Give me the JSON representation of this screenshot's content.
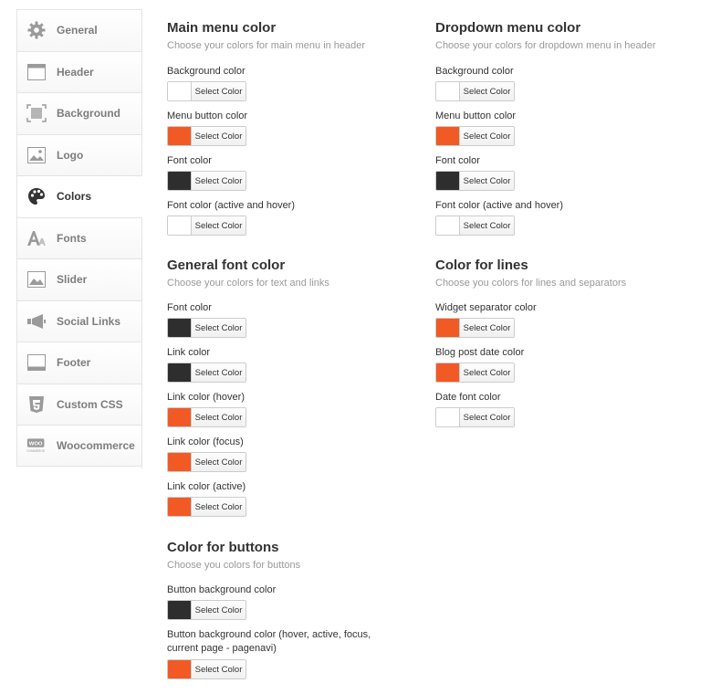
{
  "colors": {
    "orange": "#f15a24",
    "dark": "#2e2e2e",
    "white": "#ffffff"
  },
  "sidebar": {
    "items": [
      {
        "label": "General",
        "icon": "gear-icon",
        "active": false
      },
      {
        "label": "Header",
        "icon": "header-icon",
        "active": false
      },
      {
        "label": "Background",
        "icon": "background-icon",
        "active": false
      },
      {
        "label": "Logo",
        "icon": "image-icon",
        "active": false
      },
      {
        "label": "Colors",
        "icon": "palette-icon",
        "active": true
      },
      {
        "label": "Fonts",
        "icon": "font-icon",
        "active": false
      },
      {
        "label": "Slider",
        "icon": "slider-icon",
        "active": false
      },
      {
        "label": "Social Links",
        "icon": "megaphone-icon",
        "active": false
      },
      {
        "label": "Footer",
        "icon": "footer-icon",
        "active": false
      },
      {
        "label": "Custom CSS",
        "icon": "css3-icon",
        "active": false
      },
      {
        "label": "Woocommerce",
        "icon": "woocommerce-icon",
        "active": false
      }
    ]
  },
  "button_label": "Select Color",
  "sections": {
    "main_menu": {
      "title": "Main menu color",
      "subtitle": "Choose your colors for main menu in header",
      "fields": [
        {
          "label": "Background color",
          "color": "#ffffff"
        },
        {
          "label": "Menu button color",
          "color": "#f15a24"
        },
        {
          "label": "Font color",
          "color": "#2e2e2e"
        },
        {
          "label": "Font color (active and hover)",
          "color": "#ffffff"
        }
      ]
    },
    "dropdown_menu": {
      "title": "Dropdown menu color",
      "subtitle": "Choose your colors for dropdown menu in header",
      "fields": [
        {
          "label": "Background color",
          "color": "#ffffff"
        },
        {
          "label": "Menu button color",
          "color": "#f15a24"
        },
        {
          "label": "Font color",
          "color": "#2e2e2e"
        },
        {
          "label": "Font color (active and hover)",
          "color": "#ffffff"
        }
      ]
    },
    "general_font": {
      "title": "General font color",
      "subtitle": "Choose your colors for text and links",
      "fields": [
        {
          "label": "Font color",
          "color": "#2e2e2e"
        },
        {
          "label": "Link color",
          "color": "#2e2e2e"
        },
        {
          "label": "Link color (hover)",
          "color": "#f15a24"
        },
        {
          "label": "Link color (focus)",
          "color": "#f15a24"
        },
        {
          "label": "Link color (active)",
          "color": "#f15a24"
        }
      ]
    },
    "lines": {
      "title": "Color for lines",
      "subtitle": "Choose you colors for lines and separators",
      "fields": [
        {
          "label": "Widget separator color",
          "color": "#f15a24"
        },
        {
          "label": "Blog post date color",
          "color": "#f15a24"
        },
        {
          "label": "Date font color",
          "color": "#ffffff"
        }
      ]
    },
    "buttons": {
      "title": "Color for buttons",
      "subtitle": "Choose you colors for buttons",
      "fields": [
        {
          "label": "Button background color",
          "color": "#2e2e2e"
        },
        {
          "label_line1": "Button background color (hover, active, focus,",
          "label_line2": "current page - pagenavi)",
          "color": "#f15a24"
        }
      ]
    }
  }
}
